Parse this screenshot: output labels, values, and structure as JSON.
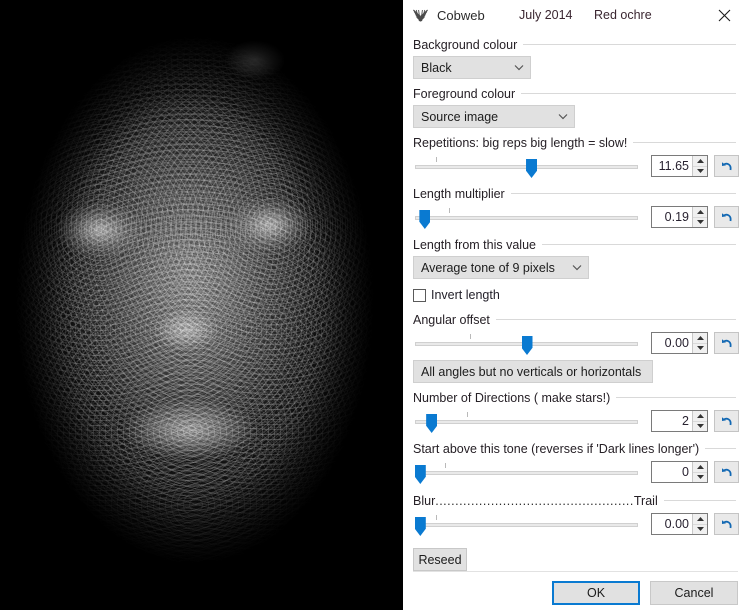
{
  "titlebar": {
    "icon": "cobweb-icon",
    "title": "Cobweb",
    "date": "July 2014",
    "author": "Red ochre",
    "close_label": "✕"
  },
  "preview": {
    "alt": "Cobweb filter preview of a portrait rendered as swirling white fibres on black"
  },
  "panel": {
    "background_colour": {
      "group_label": "Background colour",
      "value": "Black",
      "chevron": "chevron-down-icon"
    },
    "foreground_colour": {
      "group_label": "Foreground colour",
      "value": "Source image",
      "chevron": "chevron-down-icon"
    },
    "repetitions": {
      "group_label": "Repetitions:    big reps  big length = slow!",
      "value": "11.65",
      "thumb_pct": 52,
      "tick_pct": 10
    },
    "length_multiplier": {
      "group_label": "Length multiplier",
      "value": "0.19",
      "thumb_pct": 5,
      "tick_pct": 16
    },
    "length_from": {
      "group_label": "Length from this value",
      "value": "Average tone of 9 pixels",
      "chevron": "chevron-down-icon"
    },
    "invert_length": {
      "label": "Invert length",
      "checked": false
    },
    "angular_offset": {
      "group_label": "Angular offset",
      "value": "0.00",
      "thumb_pct": 50,
      "tick_pct": 25
    },
    "angle_mode": {
      "value": "All angles but no verticals or horizontals",
      "chevron": "chevron-down-icon"
    },
    "number_of_directions": {
      "group_label": "Number of Directions ( make stars!)",
      "value": "2",
      "thumb_pct": 8,
      "tick_pct": 24
    },
    "start_above_tone": {
      "group_label": "Start above this tone (reverses if 'Dark lines longer')",
      "value": "0",
      "thumb_pct": 3,
      "tick_pct": 14
    },
    "blur_trail": {
      "lead_label": "Blur",
      "dots": "..................................................",
      "tail_label": "Trail",
      "value": "0.00",
      "thumb_pct": 3,
      "tick_pct": 10
    },
    "reseed_label": "Reseed",
    "spinner_up_icon": "caret-up-icon",
    "spinner_down_icon": "caret-down-icon",
    "reset_icon": "undo-arrow-icon"
  },
  "footer": {
    "ok_label": "OK",
    "cancel_label": "Cancel"
  },
  "colors": {
    "accent": "#0a7ad1",
    "panel_bg": "#ffffff",
    "control_bg": "#e1e1e1",
    "preview_bg": "#000000",
    "label_text": "#262026",
    "meta_text": "#3a2630"
  }
}
